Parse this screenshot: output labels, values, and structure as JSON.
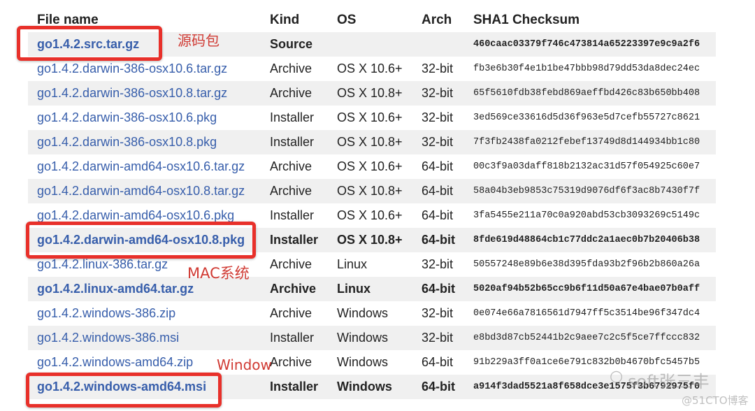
{
  "headers": {
    "file": "File name",
    "kind": "Kind",
    "os": "OS",
    "arch": "Arch",
    "sha": "SHA1 Checksum"
  },
  "rows": [
    {
      "file": "go1.4.2.src.tar.gz",
      "kind": "Source",
      "os": "",
      "arch": "",
      "sha": "460caac03379f746c473814a65223397e9c9a2f6",
      "bold": true
    },
    {
      "file": "go1.4.2.darwin-386-osx10.6.tar.gz",
      "kind": "Archive",
      "os": "OS X 10.6+",
      "arch": "32-bit",
      "sha": "fb3e6b30f4e1b1be47bbb98d79dd53da8dec24ec",
      "bold": false
    },
    {
      "file": "go1.4.2.darwin-386-osx10.8.tar.gz",
      "kind": "Archive",
      "os": "OS X 10.8+",
      "arch": "32-bit",
      "sha": "65f5610fdb38febd869aeffbd426c83b650bb408",
      "bold": false
    },
    {
      "file": "go1.4.2.darwin-386-osx10.6.pkg",
      "kind": "Installer",
      "os": "OS X 10.6+",
      "arch": "32-bit",
      "sha": "3ed569ce33616d5d36f963e5d7cefb55727c8621",
      "bold": false
    },
    {
      "file": "go1.4.2.darwin-386-osx10.8.pkg",
      "kind": "Installer",
      "os": "OS X 10.8+",
      "arch": "32-bit",
      "sha": "7f3fb2438fa0212febef13749d8d144934bb1c80",
      "bold": false
    },
    {
      "file": "go1.4.2.darwin-amd64-osx10.6.tar.gz",
      "kind": "Archive",
      "os": "OS X 10.6+",
      "arch": "64-bit",
      "sha": "00c3f9a03daff818b2132ac31d57f054925c60e7",
      "bold": false
    },
    {
      "file": "go1.4.2.darwin-amd64-osx10.8.tar.gz",
      "kind": "Archive",
      "os": "OS X 10.8+",
      "arch": "64-bit",
      "sha": "58a04b3eb9853c75319d9076df6f3ac8b7430f7f",
      "bold": false
    },
    {
      "file": "go1.4.2.darwin-amd64-osx10.6.pkg",
      "kind": "Installer",
      "os": "OS X 10.6+",
      "arch": "64-bit",
      "sha": "3fa5455e211a70c0a920abd53cb3093269c5149c",
      "bold": false
    },
    {
      "file": "go1.4.2.darwin-amd64-osx10.8.pkg",
      "kind": "Installer",
      "os": "OS X 10.8+",
      "arch": "64-bit",
      "sha": "8fde619d48864cb1c77ddc2a1aec0b7b20406b38",
      "bold": true
    },
    {
      "file": "go1.4.2.linux-386.tar.gz",
      "kind": "Archive",
      "os": "Linux",
      "arch": "32-bit",
      "sha": "50557248e89b6e38d395fda93b2f96b2b860a26a",
      "bold": false
    },
    {
      "file": "go1.4.2.linux-amd64.tar.gz",
      "kind": "Archive",
      "os": "Linux",
      "arch": "64-bit",
      "sha": "5020af94b52b65cc9b6f11d50a67e4bae07b0aff",
      "bold": true
    },
    {
      "file": "go1.4.2.windows-386.zip",
      "kind": "Archive",
      "os": "Windows",
      "arch": "32-bit",
      "sha": "0e074e66a7816561d7947ff5c3514be96f347dc4",
      "bold": false
    },
    {
      "file": "go1.4.2.windows-386.msi",
      "kind": "Installer",
      "os": "Windows",
      "arch": "32-bit",
      "sha": "e8bd3d87cb52441b2c9aee7c2c5f5ce7ffccc832",
      "bold": false
    },
    {
      "file": "go1.4.2.windows-amd64.zip",
      "kind": "Archive",
      "os": "Windows",
      "arch": "64-bit",
      "sha": "91b229a3ff0a1ce6e791c832b0b4670bfc5457b5",
      "bold": false
    },
    {
      "file": "go1.4.2.windows-amd64.msi",
      "kind": "Installer",
      "os": "Windows",
      "arch": "64-bit",
      "sha": "a914f3dad5521a8f658dce3e1575f3b6792975f0",
      "bold": true
    }
  ],
  "annotations": {
    "source": "源码包",
    "mac": "MAC系统",
    "windows": "Window"
  },
  "watermark": {
    "line1": "soft张三丰",
    "line2": "@51CTO博客"
  },
  "colors": {
    "link": "#375eab",
    "highlight": "#e8302a",
    "note": "#d03a33",
    "stripe": "#f0f0f0"
  }
}
